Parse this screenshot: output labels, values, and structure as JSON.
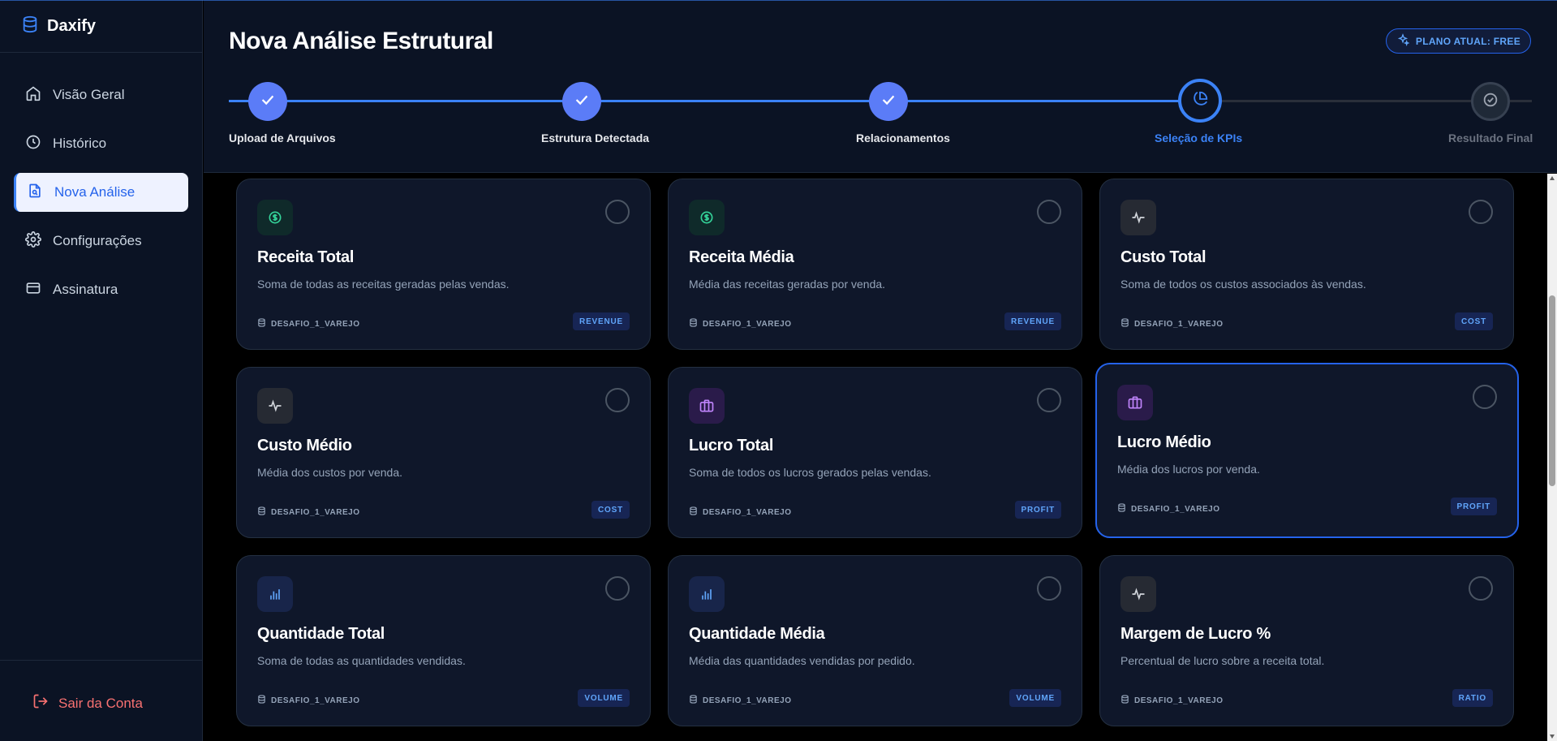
{
  "app": {
    "name": "Daxify"
  },
  "sidebar": {
    "items": [
      {
        "label": "Visão Geral",
        "icon": "home-icon",
        "active": false
      },
      {
        "label": "Histórico",
        "icon": "clock-icon",
        "active": false
      },
      {
        "label": "Nova Análise",
        "icon": "file-search-icon",
        "active": true
      },
      {
        "label": "Configurações",
        "icon": "gear-icon",
        "active": false
      },
      {
        "label": "Assinatura",
        "icon": "credit-card-icon",
        "active": false
      }
    ],
    "logout_label": "Sair da Conta"
  },
  "header": {
    "title": "Nova Análise Estrutural",
    "plan_badge": "PLANO ATUAL: FREE"
  },
  "stepper": {
    "steps": [
      {
        "label": "Upload de Arquivos",
        "state": "done"
      },
      {
        "label": "Estrutura Detectada",
        "state": "done"
      },
      {
        "label": "Relacionamentos",
        "state": "done"
      },
      {
        "label": "Seleção de KPIs",
        "state": "current"
      },
      {
        "label": "Resultado Final",
        "state": "pending"
      }
    ]
  },
  "kpis": [
    {
      "title": "Receita Total",
      "description": "Soma de todas as receitas geradas pelas vendas.",
      "source": "DESAFIO_1_VAREJO",
      "tag": "REVENUE",
      "icon": "dollar-icon",
      "selected": false
    },
    {
      "title": "Receita Média",
      "description": "Média das receitas geradas por venda.",
      "source": "DESAFIO_1_VAREJO",
      "tag": "REVENUE",
      "icon": "dollar-icon",
      "selected": false
    },
    {
      "title": "Custo Total",
      "description": "Soma de todos os custos associados às vendas.",
      "source": "DESAFIO_1_VAREJO",
      "tag": "COST",
      "icon": "activity-icon",
      "selected": false
    },
    {
      "title": "Custo Médio",
      "description": "Média dos custos por venda.",
      "source": "DESAFIO_1_VAREJO",
      "tag": "COST",
      "icon": "activity-icon",
      "selected": false
    },
    {
      "title": "Lucro Total",
      "description": "Soma de todos os lucros gerados pelas vendas.",
      "source": "DESAFIO_1_VAREJO",
      "tag": "PROFIT",
      "icon": "briefcase-icon",
      "selected": false
    },
    {
      "title": "Lucro Médio",
      "description": "Média dos lucros por venda.",
      "source": "DESAFIO_1_VAREJO",
      "tag": "PROFIT",
      "icon": "briefcase-icon",
      "selected": true
    },
    {
      "title": "Quantidade Total",
      "description": "Soma de todas as quantidades vendidas.",
      "source": "DESAFIO_1_VAREJO",
      "tag": "VOLUME",
      "icon": "bar-chart-icon",
      "selected": false
    },
    {
      "title": "Quantidade Média",
      "description": "Média das quantidades vendidas por pedido.",
      "source": "DESAFIO_1_VAREJO",
      "tag": "VOLUME",
      "icon": "bar-chart-icon",
      "selected": false
    },
    {
      "title": "Margem de Lucro %",
      "description": "Percentual de lucro sobre a receita total.",
      "source": "DESAFIO_1_VAREJO",
      "tag": "RATIO",
      "icon": "activity-icon",
      "selected": false
    }
  ],
  "colors": {
    "accent": "#3b82f6",
    "sidebar_bg": "#0b1324",
    "card_bg": "#0f172a",
    "danger": "#f87171"
  }
}
